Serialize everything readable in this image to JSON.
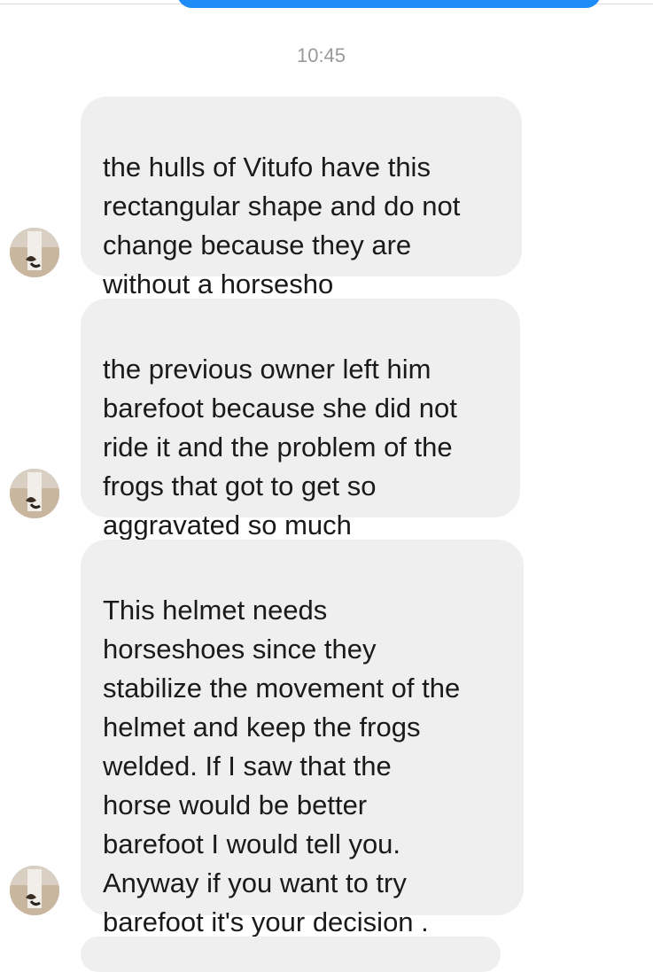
{
  "timestamp": "10:45",
  "messages": [
    {
      "text": "the hulls of Vitufo have this\nrectangular shape and do not\nchange because they are\nwithout a horsesho"
    },
    {
      "text": "the previous owner left him\nbarefoot because she did not\nride it and the problem of the\nfrogs that got to get so\naggravated so much"
    },
    {
      "text": "This helmet needs\nhorseshoes since they\nstabilize the movement of the\nhelmet and keep the frogs\nwelded. If I saw that the\nhorse would be better\nbarefoot I would tell you.\nAnyway if you want to try\nbarefoot it's your decision ."
    }
  ],
  "colors": {
    "incoming_bubble": "#efefef",
    "outgoing_bubble": "#1d8cf8",
    "timestamp": "#9a9a9a"
  },
  "icons": {
    "avatar": "contact-avatar"
  }
}
